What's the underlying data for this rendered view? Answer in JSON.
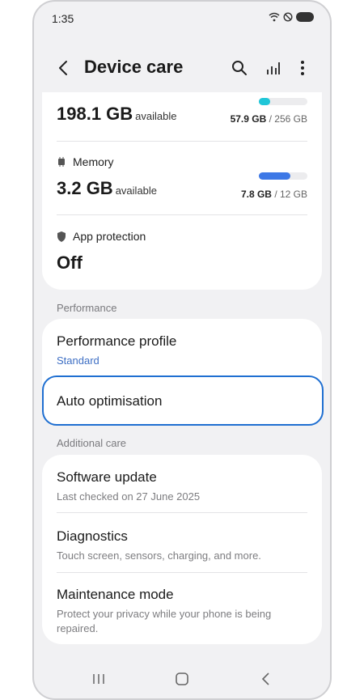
{
  "status_bar": {
    "time": "1:35"
  },
  "header": {
    "title": "Device care"
  },
  "storage": {
    "value": "198.1 GB",
    "suffix": "available",
    "used": "57.9 GB",
    "total": "/ 256 GB",
    "used_fraction": 0.226
  },
  "memory": {
    "label": "Memory",
    "value": "3.2 GB",
    "suffix": "available",
    "used": "7.8 GB",
    "total": "/ 12 GB",
    "used_fraction": 0.65
  },
  "app_protection": {
    "label": "App protection",
    "value": "Off"
  },
  "sections": {
    "performance": "Performance",
    "additional_care": "Additional care"
  },
  "performance_items": [
    {
      "title": "Performance profile",
      "subtitle": "Standard"
    },
    {
      "title": "Auto optimisation"
    }
  ],
  "additional_items": [
    {
      "title": "Software update",
      "subtitle": "Last checked on 27 June 2025"
    },
    {
      "title": "Diagnostics",
      "subtitle": "Touch screen, sensors, charging, and more."
    },
    {
      "title": "Maintenance mode",
      "subtitle": "Protect your privacy while your phone is being repaired."
    }
  ],
  "colors": {
    "storage_bar": "#1fc6d8",
    "memory_bar": "#3d78e6",
    "highlight": "#1f6fd1"
  }
}
